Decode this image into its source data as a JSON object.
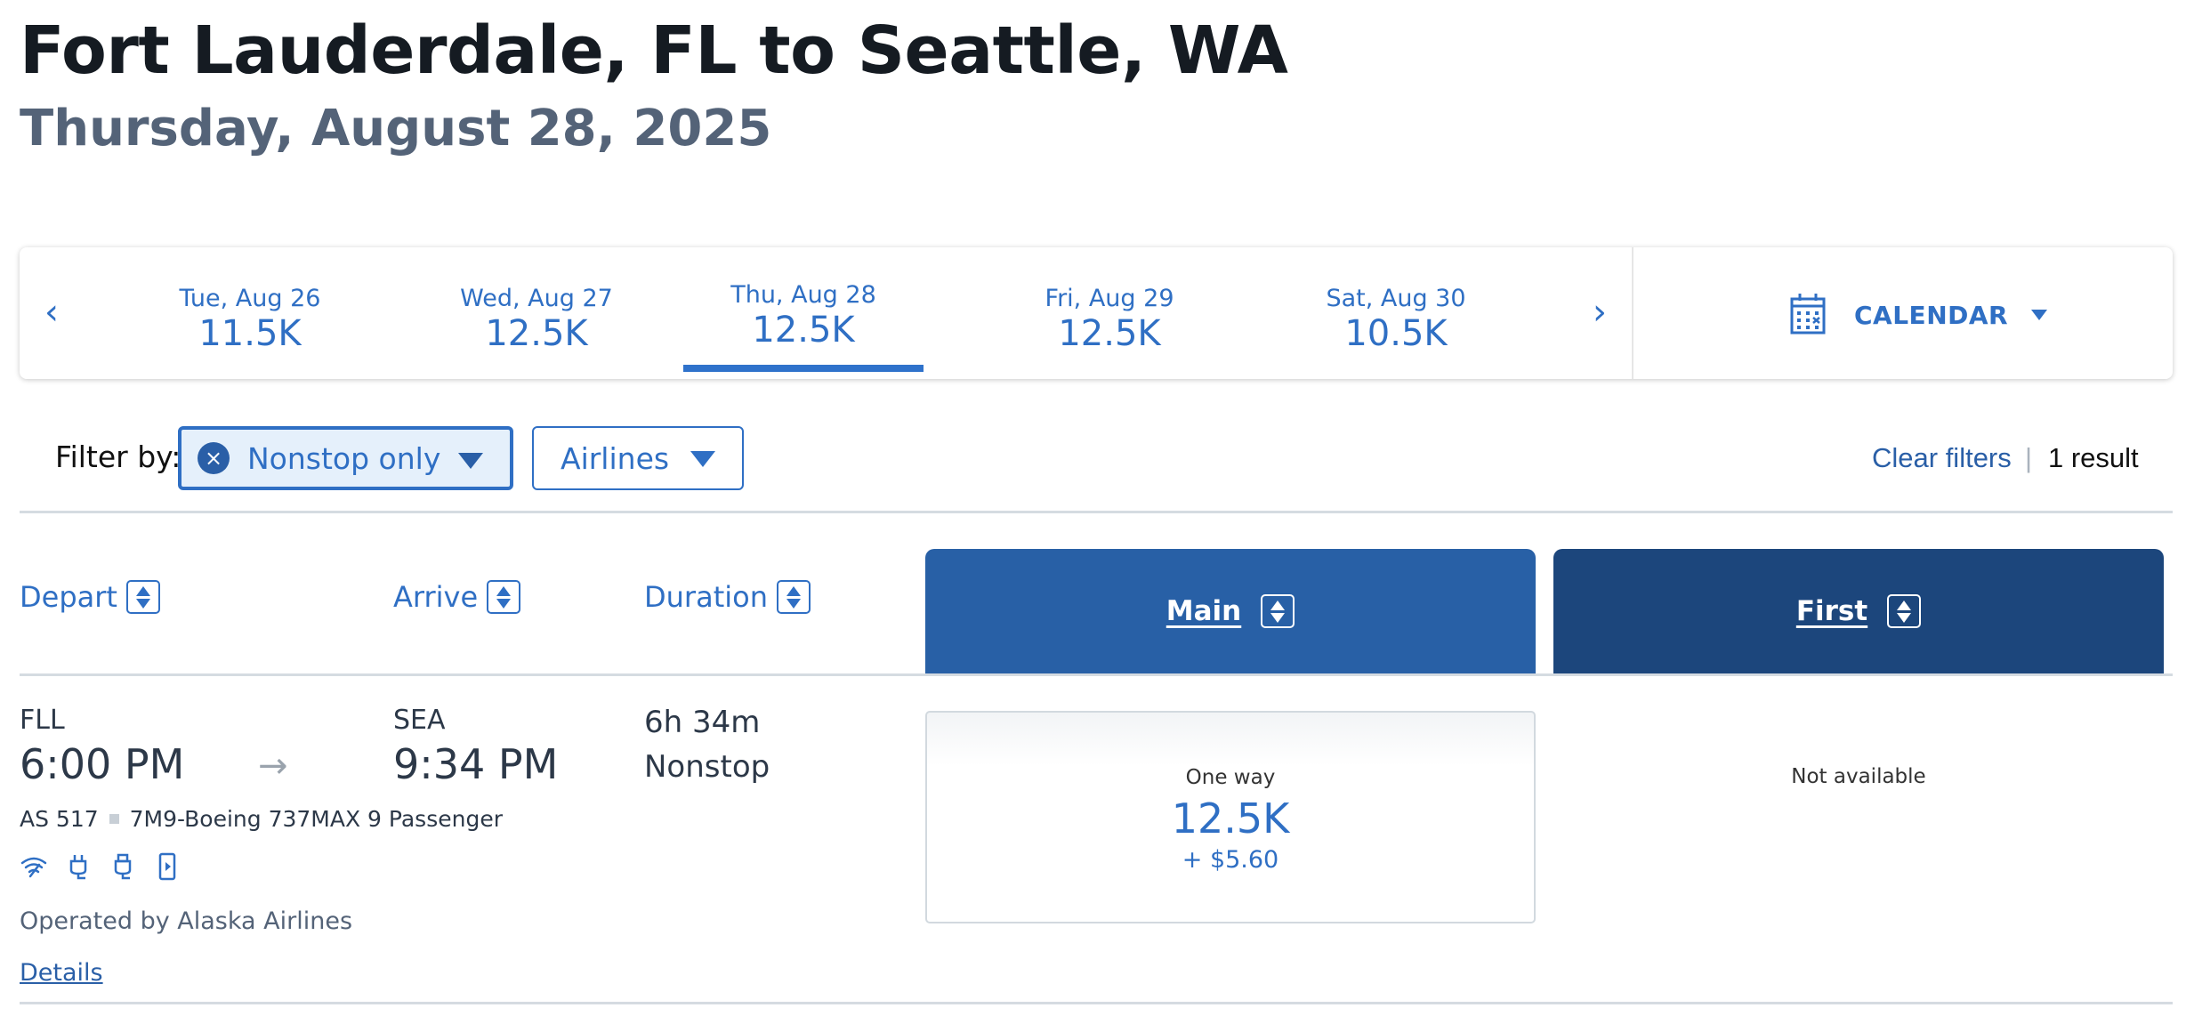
{
  "header": {
    "title": "Fort Lauderdale, FL to Seattle, WA",
    "subtitle": "Thursday, August 28, 2025"
  },
  "date_strip": {
    "prev_icon": "‹",
    "next_icon": "›",
    "dates": [
      {
        "label": "Tue, Aug 26",
        "price": "11.5K",
        "selected": false
      },
      {
        "label": "Wed, Aug 27",
        "price": "12.5K",
        "selected": false
      },
      {
        "label": "Thu, Aug 28",
        "price": "12.5K",
        "selected": true
      },
      {
        "label": "Fri, Aug 29",
        "price": "12.5K",
        "selected": false
      },
      {
        "label": "Sat, Aug 30",
        "price": "10.5K",
        "selected": false
      }
    ],
    "calendar_label": "CALENDAR"
  },
  "filters": {
    "label": "Filter by:",
    "nonstop": {
      "label": "Nonstop only",
      "active": true,
      "remove_icon": "×"
    },
    "airlines": {
      "label": "Airlines"
    },
    "clear_label": "Clear filters",
    "separator": "|",
    "result_count": "1 result"
  },
  "columns": {
    "depart": "Depart",
    "arrive": "Arrive",
    "duration": "Duration",
    "main": "Main",
    "first": "First"
  },
  "flights": [
    {
      "origin": "FLL",
      "depart_time": "6:00 PM",
      "arrow": "→",
      "destination": "SEA",
      "arrive_time": "9:34 PM",
      "duration": "6h 34m",
      "stops": "Nonstop",
      "flight_number": "AS 517",
      "aircraft": "7M9-Boeing 737MAX 9 Passenger",
      "amenities": [
        "wifi-icon",
        "power-outlet-icon",
        "usb-icon",
        "streaming-entertainment-icon"
      ],
      "operated_by": "Operated by Alaska Airlines",
      "details_label": "Details",
      "main_fare": {
        "label": "One way",
        "price": "12.5K",
        "fee": "+ $5.60"
      },
      "first_fare": {
        "label": "Not available"
      }
    }
  ],
  "colors": {
    "accent": "#2f6fc4",
    "main_header": "#2860a6",
    "first_header": "#1c467c",
    "subtitle": "#546378"
  }
}
